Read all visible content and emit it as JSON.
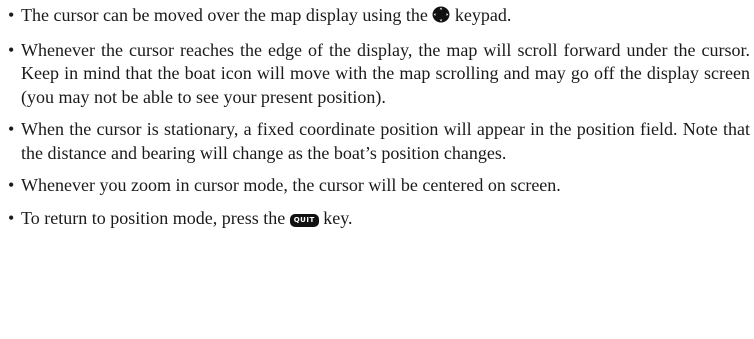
{
  "bullets": [
    {
      "before": "The cursor can be moved over the map display using the",
      "icon": "keypad-arrow-icon",
      "after": "keypad."
    },
    {
      "text": "Whenever the cursor reaches the edge of the display, the map will scroll forward under the cursor. Keep in mind that the boat icon will move with the map scrolling and may go off the display screen (you may not be able to see your present position)."
    },
    {
      "text": "When the cursor is stationary, a fixed coordinate position will appear in the position field. Note that the distance and bearing will change as the boat’s position changes."
    },
    {
      "text": "Whenever you zoom in cursor mode, the cursor will be centered on screen."
    },
    {
      "before": "To return to position mode, press the",
      "key_label": "QUIT",
      "after": "key."
    }
  ],
  "bullet_glyph": "•"
}
